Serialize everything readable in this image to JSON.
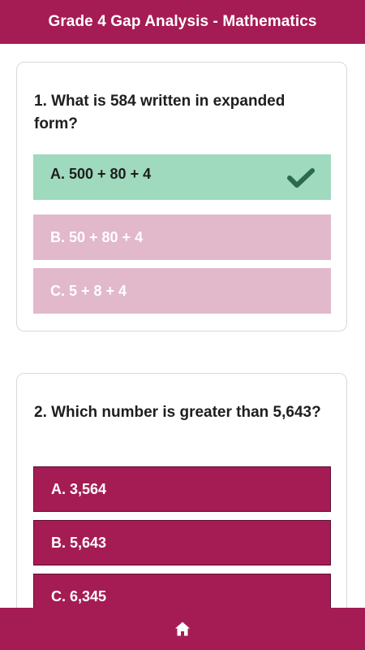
{
  "header": {
    "title": "Grade 4 Gap Analysis - Mathematics"
  },
  "colors": {
    "brand": "#a51c54",
    "correct": "#9fd9be",
    "wrong_faded": "#e2b8cb",
    "check": "#2a6b4d"
  },
  "questions": [
    {
      "text": "1. What is 584 written in expanded form?",
      "options": [
        {
          "label": "A. 500 + 80 + 4",
          "state": "correct",
          "icon": "check-icon"
        },
        {
          "label": "B. 50 + 80 + 4",
          "state": "incorrect"
        },
        {
          "label": "C. 5 + 8 + 4",
          "state": "incorrect"
        }
      ]
    },
    {
      "text": "2. Which number is greater than 5,643?",
      "options": [
        {
          "label": "A. 3,564",
          "state": "unanswered"
        },
        {
          "label": "B. 5,643",
          "state": "unanswered"
        },
        {
          "label": "C. 6,345",
          "state": "unanswered"
        }
      ]
    }
  ],
  "footer": {
    "icon": "home-icon"
  }
}
